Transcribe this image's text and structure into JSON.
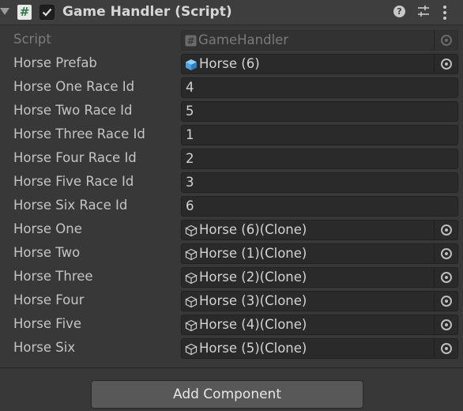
{
  "component": {
    "title": "Game Handler (Script)",
    "script_badge": "#",
    "enabled": true,
    "icons": {
      "help": "help-icon",
      "presets": "presets-sliders-icon",
      "menu": "kebab-menu-icon"
    }
  },
  "fields": {
    "script": {
      "label": "Script",
      "value": "GameHandler",
      "icon": "script-icon"
    },
    "prefab": {
      "label": "Horse Prefab",
      "value": "Horse (6)",
      "icon": "prefab-cube-icon"
    },
    "race_one": {
      "label": "Horse One Race Id",
      "value": "4"
    },
    "race_two": {
      "label": "Horse Two Race Id",
      "value": "5"
    },
    "race_three": {
      "label": "Horse Three Race Id",
      "value": "1"
    },
    "race_four": {
      "label": "Horse Four Race Id",
      "value": "2"
    },
    "race_five": {
      "label": "Horse Five Race Id",
      "value": "3"
    },
    "race_six": {
      "label": "Horse Six Race Id",
      "value": "6"
    },
    "horse_one": {
      "label": "Horse One",
      "value": "Horse (6)(Clone)",
      "icon": "gameobject-cube-icon"
    },
    "horse_two": {
      "label": "Horse Two",
      "value": "Horse (1)(Clone)",
      "icon": "gameobject-cube-icon"
    },
    "horse_three": {
      "label": "Horse Three",
      "value": "Horse (2)(Clone)",
      "icon": "gameobject-cube-icon"
    },
    "horse_four": {
      "label": "Horse Four",
      "value": "Horse (3)(Clone)",
      "icon": "gameobject-cube-icon"
    },
    "horse_five": {
      "label": "Horse Five",
      "value": "Horse (4)(Clone)",
      "icon": "gameobject-cube-icon"
    },
    "horse_six": {
      "label": "Horse Six",
      "value": "Horse (5)(Clone)",
      "icon": "gameobject-cube-icon"
    }
  },
  "footer": {
    "add_component_label": "Add Component"
  },
  "colors": {
    "panel_bg": "#383838",
    "field_bg": "#2a2a2a",
    "prefab_blue": "#4aa3e8",
    "script_green": "#2e7a46"
  }
}
